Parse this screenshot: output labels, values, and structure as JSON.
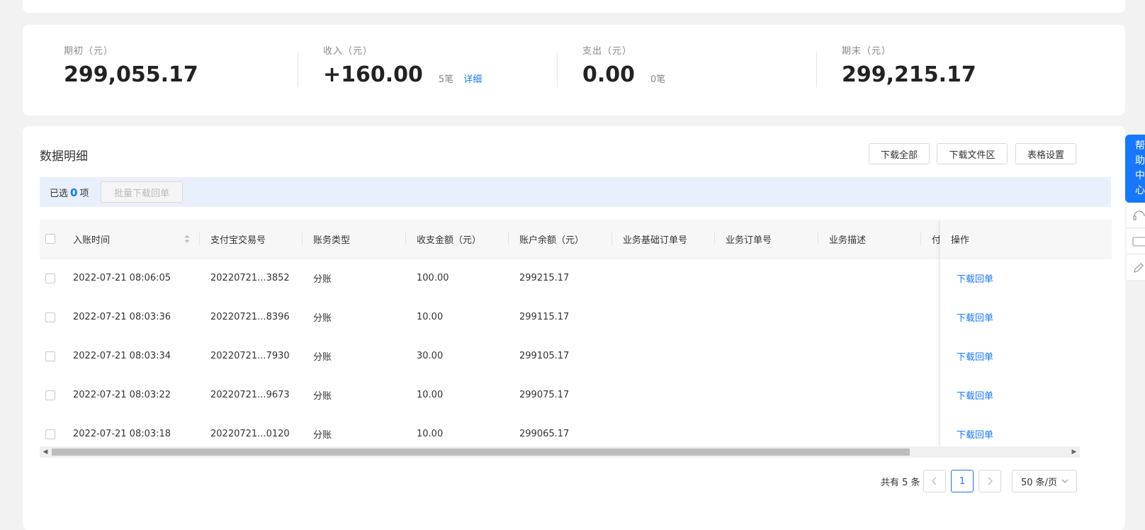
{
  "summary": {
    "opening": {
      "label": "期初（元）",
      "value": "299,055.17"
    },
    "income": {
      "label": "收入（元）",
      "value": "+160.00",
      "count": "5笔",
      "detail_link": "详细"
    },
    "expense": {
      "label": "支出（元）",
      "value": "0.00",
      "count": "0笔"
    },
    "closing": {
      "label": "期末（元）",
      "value": "299,215.17"
    }
  },
  "detail": {
    "title": "数据明细",
    "buttons": {
      "download_all": "下载全部",
      "download_files": "下载文件区",
      "table_settings": "表格设置"
    },
    "selection": {
      "prefix": "已选",
      "count": "0",
      "suffix": "项",
      "batch_button": "批量下载回单"
    }
  },
  "table": {
    "columns": [
      "入账时间",
      "支付宝交易号",
      "账务类型",
      "收支金额（元）",
      "账户余额（元）",
      "业务基础订单号",
      "业务订单号",
      "业务描述",
      "付",
      "操作"
    ],
    "rows": [
      {
        "time": "2022-07-21 08:06:05",
        "trade_no": "20220721...3852",
        "type": "分账",
        "amount": "100.00",
        "balance": "299215.17",
        "action": "下载回单"
      },
      {
        "time": "2022-07-21 08:03:36",
        "trade_no": "20220721...8396",
        "type": "分账",
        "amount": "10.00",
        "balance": "299115.17",
        "action": "下载回单"
      },
      {
        "time": "2022-07-21 08:03:34",
        "trade_no": "20220721...7930",
        "type": "分账",
        "amount": "30.00",
        "balance": "299105.17",
        "action": "下载回单"
      },
      {
        "time": "2022-07-21 08:03:22",
        "trade_no": "20220721...9673",
        "type": "分账",
        "amount": "10.00",
        "balance": "299075.17",
        "action": "下载回单"
      },
      {
        "time": "2022-07-21 08:03:18",
        "trade_no": "20220721...0120",
        "type": "分账",
        "amount": "10.00",
        "balance": "299065.17",
        "action": "下载回单"
      }
    ]
  },
  "pagination": {
    "total": "共有 5 条",
    "current_page": "1",
    "page_size": "50 条/页"
  },
  "help": {
    "label_chars": [
      "帮",
      "助",
      "中",
      "心"
    ]
  },
  "colors": {
    "accent": "#1677ff",
    "selection_bar": "#e8f0fd"
  }
}
